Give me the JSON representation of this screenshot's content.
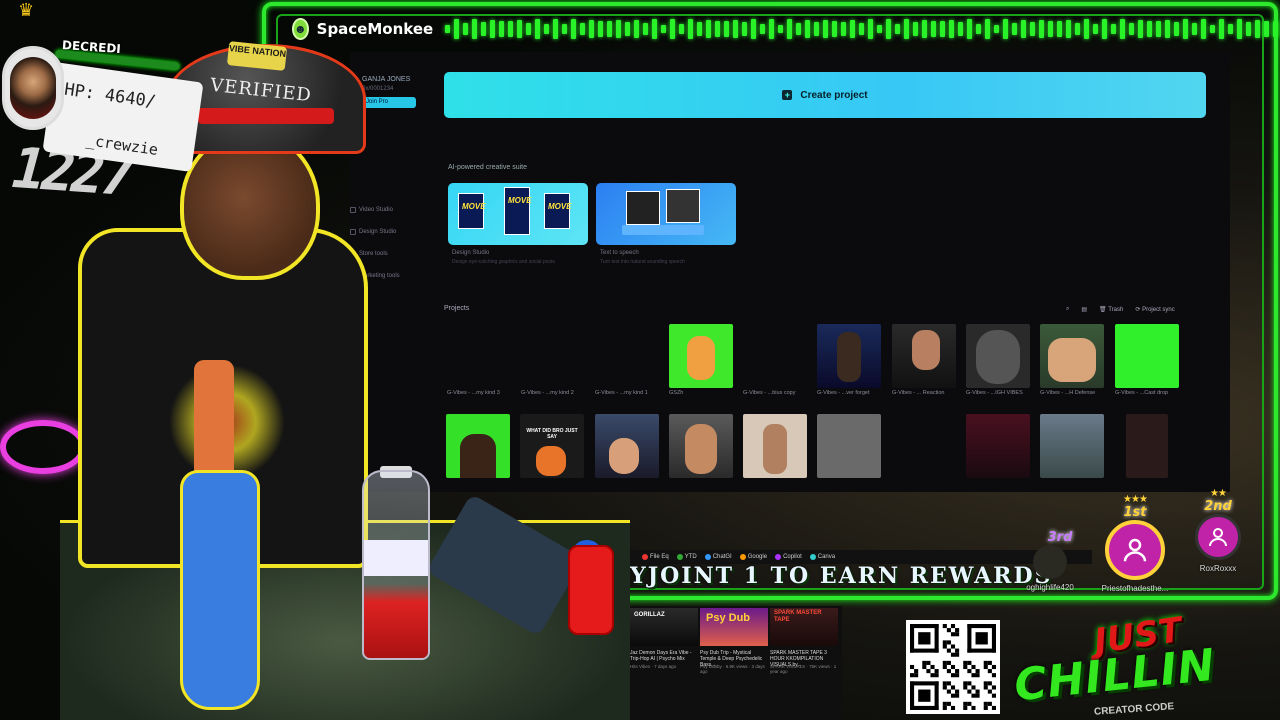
{
  "overlay": {
    "brand_name": "SpaceMonkee",
    "viewer_top": "DECREDI",
    "hp_text": "HP: 4640/",
    "username": "_crewzie",
    "big_number": "1227",
    "hat_text": "VERIFIED",
    "hat_badge": "VIBE NATION",
    "ticker": "YJOINT 1 TO EARN REWARDS",
    "chill_top": "JUST",
    "chill_main": "CHILLIN",
    "chill_under": "CREATOR CODE"
  },
  "leaderboard": [
    {
      "rank": "1st",
      "name": "Priestofhadesthe...",
      "color": "#ffd23a"
    },
    {
      "rank": "2nd",
      "name": "RoxRoxxx",
      "color": "#ffd23a"
    },
    {
      "rank": "3rd",
      "name": "oghighlife420",
      "color": "#c77dff"
    }
  ],
  "app": {
    "user": {
      "name": "GANJA JONES",
      "sub": "0x/0001234",
      "join_label": "Join Pro"
    },
    "sidebar": [
      {
        "label": "Video Studio"
      },
      {
        "label": "Design Studio"
      },
      {
        "label": "Store tools"
      },
      {
        "label": "Marketing tools"
      }
    ],
    "create_label": "Create project",
    "suite_title": "AI-powered creative suite",
    "cards": [
      {
        "label": "Design Studio",
        "sub": "Design eye-catching graphics and social posts"
      },
      {
        "label": "Text to speech",
        "sub": "Turn text into natural sounding speech"
      }
    ],
    "projects_title": "Projects",
    "tools": [
      "Trash",
      "Project sync"
    ],
    "row1": [
      {
        "label": "G-Vibes - ...my kind 3"
      },
      {
        "label": "G-Vibes - ...my kind 2"
      },
      {
        "label": "G-Vibes - ...my kind 1"
      },
      {
        "label": "GSZh"
      },
      {
        "label": "G-Vibes - ...bius copy"
      },
      {
        "label": "G-Vibes - ...ver forget"
      },
      {
        "label": "G-Vibes - ... Reaction"
      },
      {
        "label": "G-Vibes - ...IGH VIBES"
      },
      {
        "label": "G-Vibes - ...H Defense"
      },
      {
        "label": "G-Vibes - ...Cast drop"
      }
    ],
    "row2_caption": "WHAT DID BRO JUST SAY"
  },
  "taskbar": [
    "File Eq",
    "YTD",
    "ChatGI",
    "Google",
    "Copilot",
    "Canva"
  ],
  "videos": [
    {
      "title": "Jaz Demon Days Era Vibe - Trip-Hop AI | Psycho Mix",
      "meta": "Hits Vibes · 7 days ago",
      "thumb_text": "GORILLAZ"
    },
    {
      "title": "Psy Dub Trip - Mystical Temple & Deep Psychedelic Bass...",
      "meta": "Psy Dubby · 5.9K views · 3 days ago",
      "thumb_text": "Psy Dub"
    },
    {
      "title": "SPARK MASTER TAPE 3 HOUR KKOMPILATION VISUALS by...",
      "meta": "SPARK VISUALS · 75K views · 1 year ago",
      "thumb_text": "SPARK MASTER TAPE"
    }
  ],
  "colors": {
    "neon_green": "#2ee82e",
    "cyan_button": "#2fe0e8",
    "outline_yellow": "#f2e526",
    "avatar_magenta": "#c023a8"
  }
}
